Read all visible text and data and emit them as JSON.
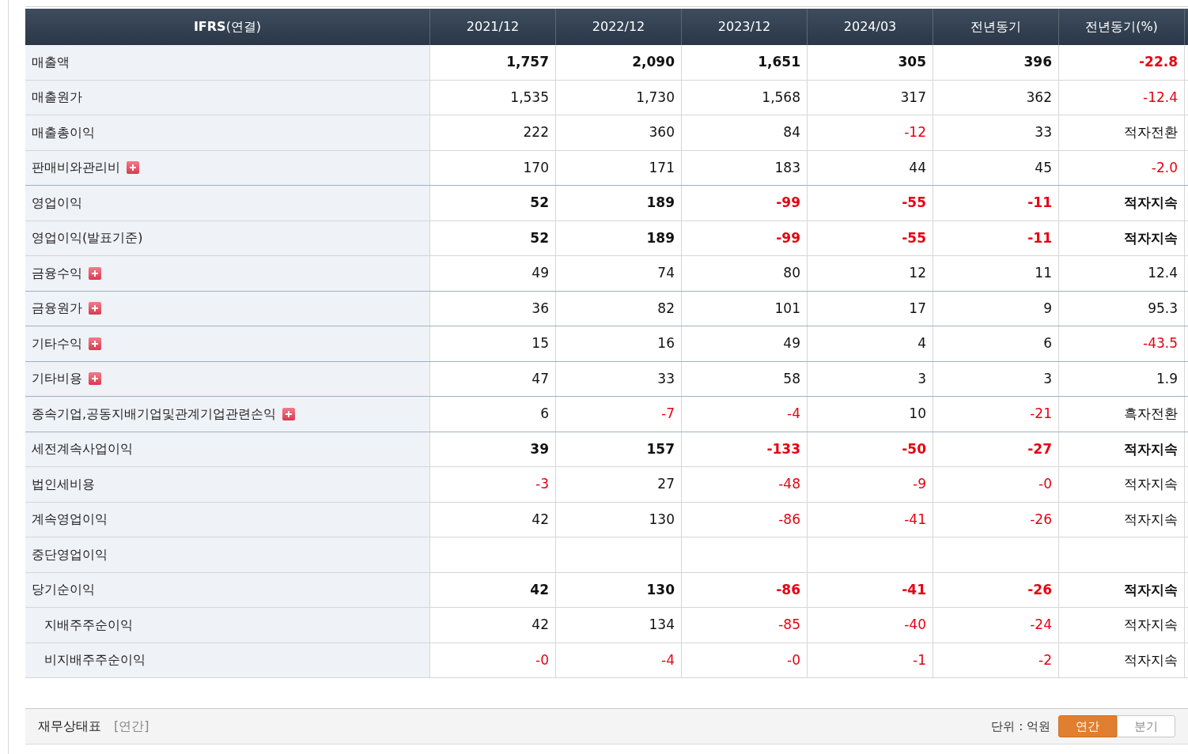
{
  "table": {
    "columns": [
      {
        "label": "**IFRS**(연결)"
      },
      {
        "label": "2021/12"
      },
      {
        "label": "2022/12"
      },
      {
        "label": "2023/12"
      },
      {
        "label": "2024/03"
      },
      {
        "label": "전년동기"
      },
      {
        "label": "전년동기(%)"
      }
    ],
    "rows": [
      {
        "label": "매출액",
        "bold": true,
        "expandable": false,
        "cells": [
          {
            "value": "1,757",
            "negative": false
          },
          {
            "value": "2,090",
            "negative": false
          },
          {
            "value": "1,651",
            "negative": false
          },
          {
            "value": "305",
            "negative": false
          },
          {
            "value": "396",
            "negative": false
          },
          {
            "value": "-22.8",
            "negative": true
          }
        ]
      },
      {
        "label": "매출원가",
        "bold": false,
        "expandable": false,
        "cells": [
          {
            "value": "1,535",
            "negative": false
          },
          {
            "value": "1,730",
            "negative": false
          },
          {
            "value": "1,568",
            "negative": false
          },
          {
            "value": "317",
            "negative": false
          },
          {
            "value": "362",
            "negative": false
          },
          {
            "value": "-12.4",
            "negative": true
          }
        ]
      },
      {
        "label": "매출총이익",
        "bold": false,
        "expandable": false,
        "cells": [
          {
            "value": "222",
            "negative": false
          },
          {
            "value": "360",
            "negative": false
          },
          {
            "value": "84",
            "negative": false
          },
          {
            "value": "-12",
            "negative": true
          },
          {
            "value": "33",
            "negative": false
          },
          {
            "value": "적자전환",
            "negative": false
          }
        ]
      },
      {
        "label": "판매비와관리비",
        "bold": false,
        "expandable": true,
        "cells": [
          {
            "value": "170",
            "negative": false
          },
          {
            "value": "171",
            "negative": false
          },
          {
            "value": "183",
            "negative": false
          },
          {
            "value": "44",
            "negative": false
          },
          {
            "value": "45",
            "negative": false
          },
          {
            "value": "-2.0",
            "negative": true
          }
        ]
      },
      {
        "label": "영업이익",
        "bold": true,
        "expandable": false,
        "cells": [
          {
            "value": "52",
            "negative": false
          },
          {
            "value": "189",
            "negative": false
          },
          {
            "value": "-99",
            "negative": true
          },
          {
            "value": "-55",
            "negative": true
          },
          {
            "value": "-11",
            "negative": true
          },
          {
            "value": "적자지속",
            "negative": false
          }
        ]
      },
      {
        "label": "영업이익(발표기준)",
        "bold": true,
        "expandable": false,
        "cells": [
          {
            "value": "52",
            "negative": false
          },
          {
            "value": "189",
            "negative": false
          },
          {
            "value": "-99",
            "negative": true
          },
          {
            "value": "-55",
            "negative": true
          },
          {
            "value": "-11",
            "negative": true
          },
          {
            "value": "적자지속",
            "negative": false
          }
        ]
      },
      {
        "label": "금융수익",
        "bold": false,
        "expandable": true,
        "cells": [
          {
            "value": "49",
            "negative": false
          },
          {
            "value": "74",
            "negative": false
          },
          {
            "value": "80",
            "negative": false
          },
          {
            "value": "12",
            "negative": false
          },
          {
            "value": "11",
            "negative": false
          },
          {
            "value": "12.4",
            "negative": false
          }
        ]
      },
      {
        "label": "금융원가",
        "bold": false,
        "expandable": true,
        "cells": [
          {
            "value": "36",
            "negative": false
          },
          {
            "value": "82",
            "negative": false
          },
          {
            "value": "101",
            "negative": false
          },
          {
            "value": "17",
            "negative": false
          },
          {
            "value": "9",
            "negative": false
          },
          {
            "value": "95.3",
            "negative": false
          }
        ]
      },
      {
        "label": "기타수익",
        "bold": false,
        "expandable": true,
        "cells": [
          {
            "value": "15",
            "negative": false
          },
          {
            "value": "16",
            "negative": false
          },
          {
            "value": "49",
            "negative": false
          },
          {
            "value": "4",
            "negative": false
          },
          {
            "value": "6",
            "negative": false
          },
          {
            "value": "-43.5",
            "negative": true
          }
        ]
      },
      {
        "label": "기타비용",
        "bold": false,
        "expandable": true,
        "cells": [
          {
            "value": "47",
            "negative": false
          },
          {
            "value": "33",
            "negative": false
          },
          {
            "value": "58",
            "negative": false
          },
          {
            "value": "3",
            "negative": false
          },
          {
            "value": "3",
            "negative": false
          },
          {
            "value": "1.9",
            "negative": false
          }
        ]
      },
      {
        "label": "종속기업,공동지배기업및관계기업관련손익",
        "bold": false,
        "expandable": true,
        "cells": [
          {
            "value": "6",
            "negative": false
          },
          {
            "value": "-7",
            "negative": true
          },
          {
            "value": "-4",
            "negative": true
          },
          {
            "value": "10",
            "negative": false
          },
          {
            "value": "-21",
            "negative": true
          },
          {
            "value": "흑자전환",
            "negative": false
          }
        ]
      },
      {
        "label": "세전계속사업이익",
        "bold": true,
        "expandable": false,
        "cells": [
          {
            "value": "39",
            "negative": false
          },
          {
            "value": "157",
            "negative": false
          },
          {
            "value": "-133",
            "negative": true
          },
          {
            "value": "-50",
            "negative": true
          },
          {
            "value": "-27",
            "negative": true
          },
          {
            "value": "적자지속",
            "negative": false
          }
        ]
      },
      {
        "label": "법인세비용",
        "bold": false,
        "expandable": false,
        "cells": [
          {
            "value": "-3",
            "negative": true
          },
          {
            "value": "27",
            "negative": false
          },
          {
            "value": "-48",
            "negative": true
          },
          {
            "value": "-9",
            "negative": true
          },
          {
            "value": "-0",
            "negative": true
          },
          {
            "value": "적자지속",
            "negative": false
          }
        ]
      },
      {
        "label": "계속영업이익",
        "bold": false,
        "expandable": false,
        "cells": [
          {
            "value": "42",
            "negative": false
          },
          {
            "value": "130",
            "negative": false
          },
          {
            "value": "-86",
            "negative": true
          },
          {
            "value": "-41",
            "negative": true
          },
          {
            "value": "-26",
            "negative": true
          },
          {
            "value": "적자지속",
            "negative": false
          }
        ]
      },
      {
        "label": "중단영업이익",
        "expandable": false,
        "cells": []
      },
      {
        "label": "당기순이익",
        "bold": true,
        "expandable": false,
        "cells": [
          {
            "value": "42",
            "negative": false
          },
          {
            "value": "130",
            "negative": false
          },
          {
            "value": "-86",
            "negative": true
          },
          {
            "value": "-41",
            "negative": true
          },
          {
            "value": "-26",
            "negative": true
          },
          {
            "value": "적자지속",
            "negative": false
          }
        ],
        "children": [
          {
            "label": "지배주주순이익",
            "bold": false,
            "expandable": false,
            "cells": [
              {
                "value": "42",
                "negative": false
              },
              {
                "value": "134",
                "negative": false
              },
              {
                "value": "-85",
                "negative": true
              },
              {
                "value": "-40",
                "negative": true
              },
              {
                "value": "-24",
                "negative": true
              },
              {
                "value": "적자지속",
                "negative": false
              }
            ]
          },
          {
            "label": "비지배주주순이익",
            "bold": false,
            "expandable": false,
            "cells": [
              {
                "value": "-0",
                "negative": true
              },
              {
                "value": "-4",
                "negative": true
              },
              {
                "value": "-0",
                "negative": true
              },
              {
                "value": "-1",
                "negative": true
              },
              {
                "value": "-2",
                "negative": true
              },
              {
                "value": "적자지속",
                "negative": false
              }
            ]
          }
        ]
      }
    ]
  },
  "footer": {
    "title": "재무상태표",
    "period": "[연간]",
    "unit": "단위 : 억원",
    "toggles": [
      {
        "label": "연간",
        "selected": true
      },
      {
        "label": "분기",
        "selected": false
      }
    ]
  }
}
